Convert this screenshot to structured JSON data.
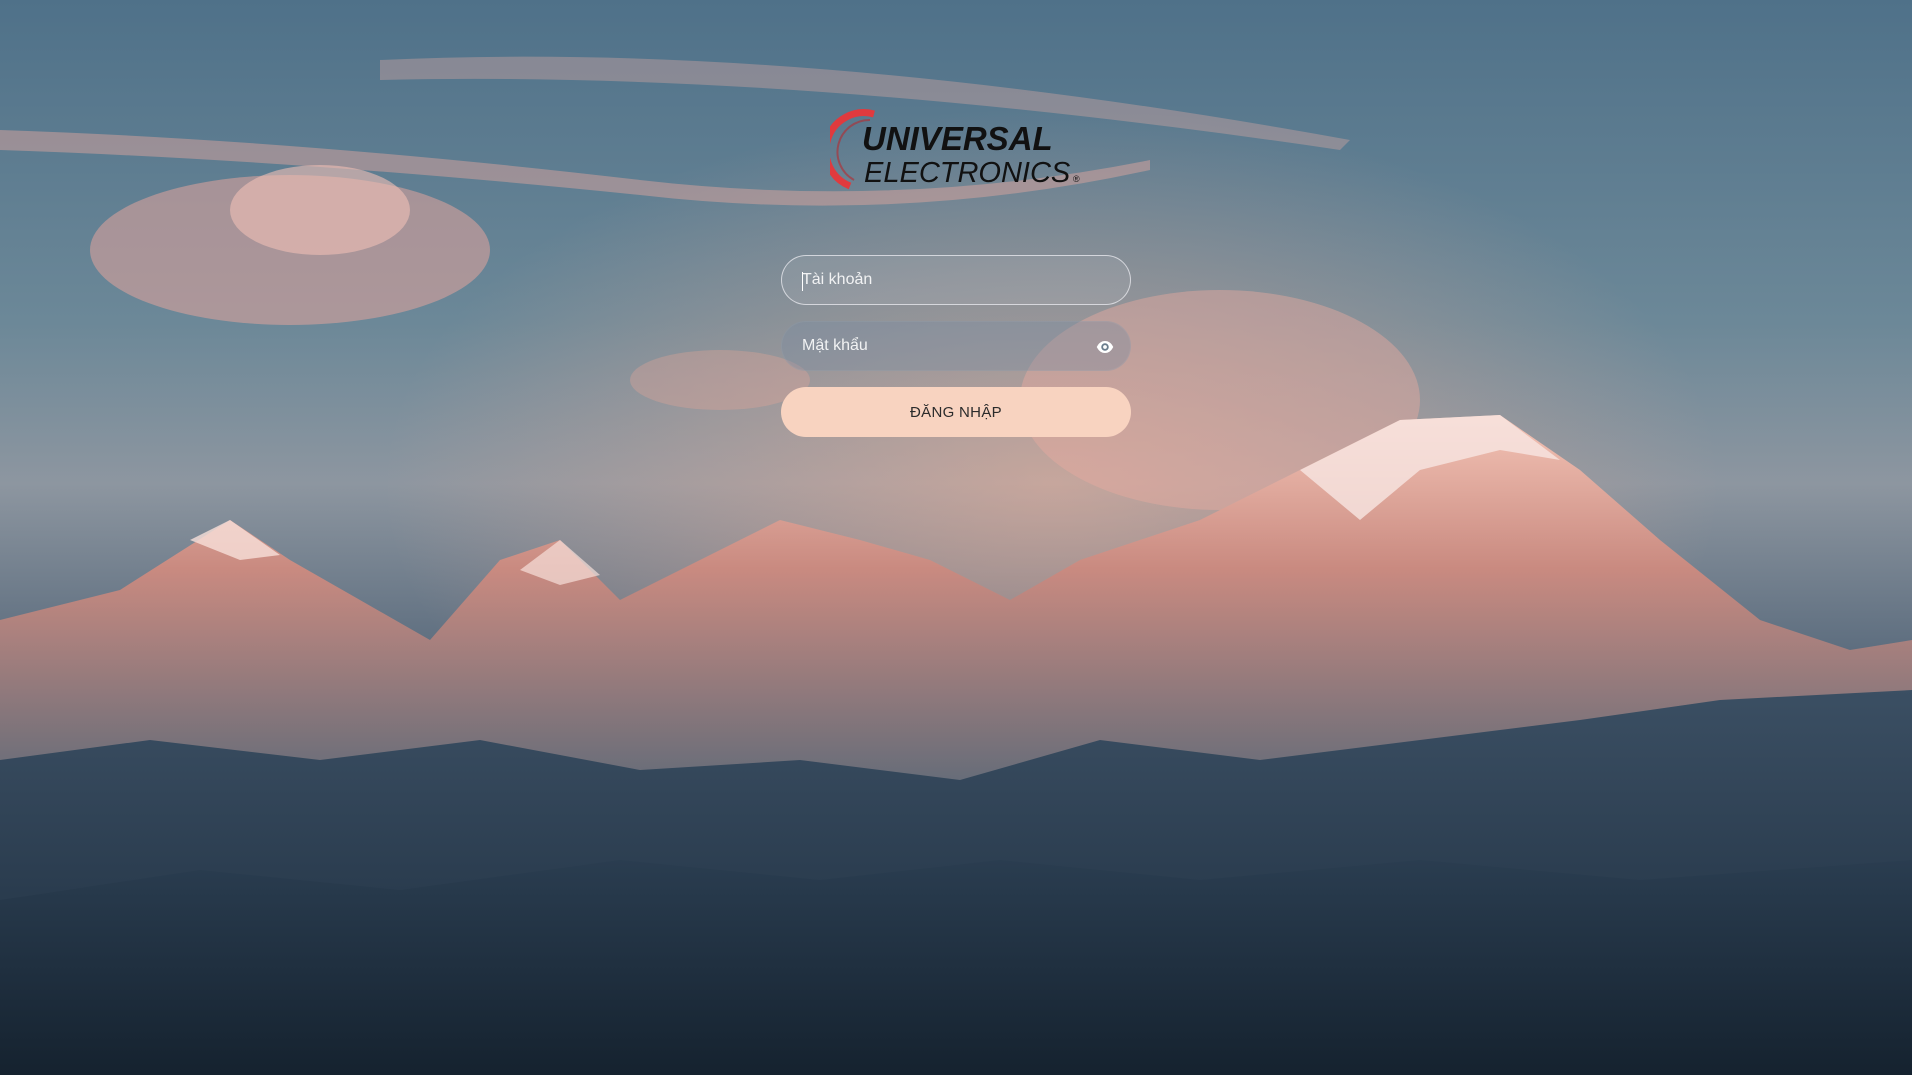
{
  "brand": {
    "name_line1": "UNIVERSAL",
    "name_line2": "ELECTRONICS",
    "registered_mark": "®",
    "accent_color": "#e03a3e"
  },
  "login": {
    "username_placeholder": "Tài khoản",
    "password_placeholder": "Mật khẩu",
    "show_password_icon": "eye-icon",
    "submit_label": "ĐĂNG NHẬP",
    "button_color": "#f8d3c0"
  }
}
